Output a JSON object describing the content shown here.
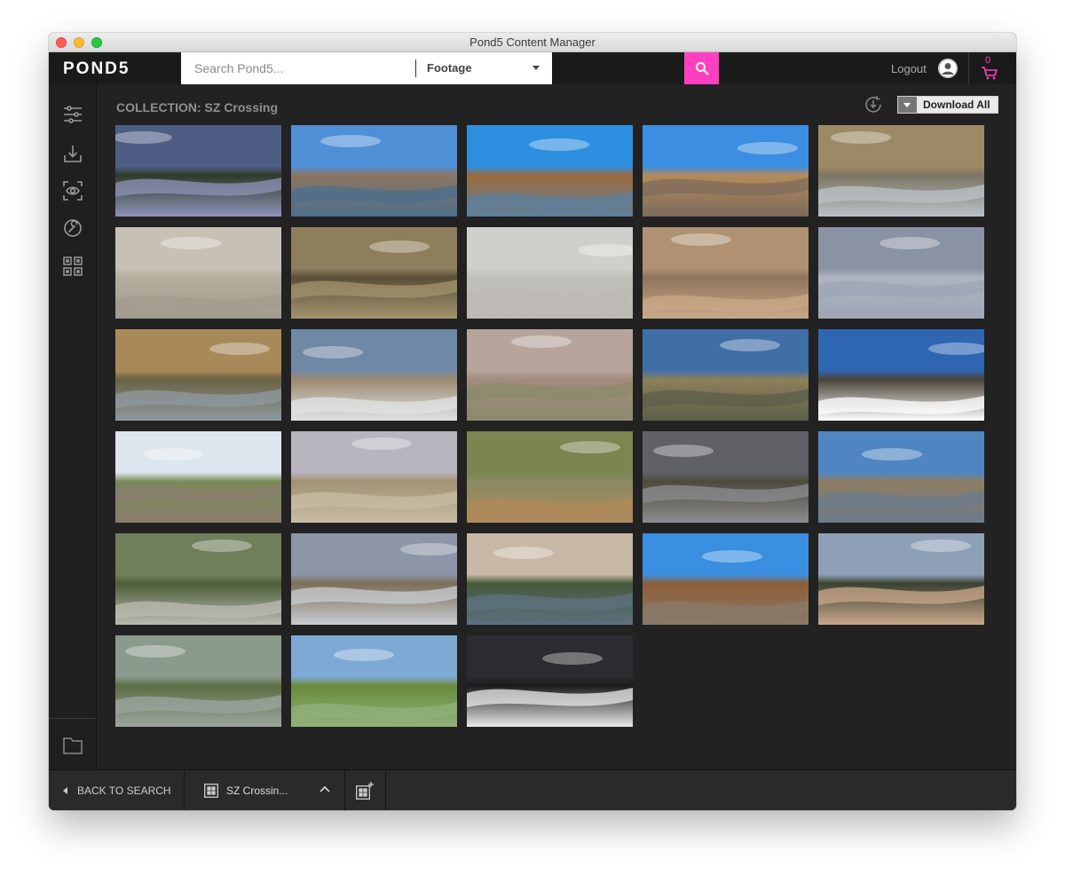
{
  "window": {
    "title": "Pond5 Content Manager"
  },
  "header": {
    "logo": "POND5",
    "search": {
      "placeholder": "Search Pond5...",
      "value": ""
    },
    "category": "Footage",
    "logout_label": "Logout",
    "cart_count": "0"
  },
  "sidebar": {
    "items": [
      {
        "icon": "sliders-icon"
      },
      {
        "icon": "download-tray-icon"
      },
      {
        "icon": "eye-scan-icon"
      },
      {
        "icon": "wrench-gear-icon"
      },
      {
        "icon": "qr-grid-icon"
      },
      {
        "icon": "folder-icon"
      }
    ]
  },
  "main": {
    "collection_title": "COLLECTION: SZ Crossing",
    "download_all_label": "Download All",
    "thumbnails": [
      {
        "scene": "river-storm-clouds",
        "colors": {
          "sky": "#4e5d84",
          "ground": "#2f3b2a",
          "water": "#8d93b8"
        }
      },
      {
        "scene": "river-canyon",
        "colors": {
          "sky": "#4f8fd6",
          "ground": "#8c7560",
          "water": "#4c6f8c"
        }
      },
      {
        "scene": "river-bridge-aerial",
        "colors": {
          "sky": "#2d8fe0",
          "ground": "#9c6a3c",
          "water": "#5e7f9c"
        }
      },
      {
        "scene": "river-desert-aerial",
        "colors": {
          "sky": "#3b8ee2",
          "ground": "#b58b5a",
          "water": "#7d6b5c"
        }
      },
      {
        "scene": "cranes-in-water",
        "colors": {
          "sky": "#9c8a66",
          "ground": "#7c7664",
          "water": "#b9c2c8"
        }
      },
      {
        "scene": "cranes-flying",
        "colors": {
          "sky": "#c7c0b4",
          "ground": "#b5ad9e",
          "water": "#a39c8e"
        }
      },
      {
        "scene": "crane-silhouettes",
        "colors": {
          "sky": "#8e7e5c",
          "ground": "#5a4e38",
          "water": "#a4946d"
        }
      },
      {
        "scene": "cranes-sky",
        "colors": {
          "sky": "#d1cfcb",
          "ground": "#c1bfba",
          "water": "#bdbab4"
        }
      },
      {
        "scene": "cranes-wading",
        "colors": {
          "sky": "#b09272",
          "ground": "#8d7459",
          "water": "#c9a887"
        }
      },
      {
        "scene": "cranes-blue-sky",
        "colors": {
          "sky": "#8a93a4",
          "ground": "#aeb4c1",
          "water": "#9ea6b5"
        }
      },
      {
        "scene": "cranes-wetland",
        "colors": {
          "sky": "#a88a5a",
          "ground": "#6a6244",
          "water": "#8f9aa0"
        }
      },
      {
        "scene": "snow-geese-flock",
        "colors": {
          "sky": "#6f88a6",
          "ground": "#9c8a70",
          "water": "#e1e3e6"
        }
      },
      {
        "scene": "desert-plain-aerial",
        "colors": {
          "sky": "#b7a59c",
          "ground": "#a18c7c",
          "water": "#8c8a6c"
        }
      },
      {
        "scene": "plain-clouds-shadow",
        "colors": {
          "sky": "#3f6fa6",
          "ground": "#8e7f5a",
          "water": "#5c5f4a"
        }
      },
      {
        "scene": "mesa-clouds",
        "colors": {
          "sky": "#2f66b2",
          "ground": "#4a4236",
          "water": "#ffffff"
        }
      },
      {
        "scene": "train-tracks",
        "colors": {
          "sky": "#dde6ee",
          "ground": "#7a8a58",
          "water": "#8a7d6c"
        }
      },
      {
        "scene": "rainbow-hills",
        "colors": {
          "sky": "#b9b5bf",
          "ground": "#a19274",
          "water": "#c8bda4"
        }
      },
      {
        "scene": "freight-train-scrub",
        "colors": {
          "sky": "#7a8550",
          "ground": "#8a8a62",
          "water": "#b08a5a"
        }
      },
      {
        "scene": "storm-cell",
        "colors": {
          "sky": "#5f6166",
          "ground": "#4e4a3c",
          "water": "#8b8c90"
        }
      },
      {
        "scene": "mountains-clouds",
        "colors": {
          "sky": "#4f86c2",
          "ground": "#8e7d63",
          "water": "#6c7b8c"
        }
      },
      {
        "scene": "highway-aerial",
        "colors": {
          "sky": "#6f7f5a",
          "ground": "#4d5f3a",
          "water": "#bcbab2"
        }
      },
      {
        "scene": "clouds-plain",
        "colors": {
          "sky": "#8c96a6",
          "ground": "#7d6e58",
          "water": "#c8ccd2"
        }
      },
      {
        "scene": "flooded-town",
        "colors": {
          "sky": "#c8b8a6",
          "ground": "#46593a",
          "water": "#5d7180"
        }
      },
      {
        "scene": "river-bosque-aerial",
        "colors": {
          "sky": "#3a8fe0",
          "ground": "#8e5e36",
          "water": "#8a7a6a"
        }
      },
      {
        "scene": "city-dusk",
        "colors": {
          "sky": "#8ea0b5",
          "ground": "#3b4230",
          "water": "#c9a78c"
        }
      },
      {
        "scene": "riverbank-reflection",
        "colors": {
          "sky": "#8a9a8c",
          "ground": "#5c6e42",
          "water": "#9ca6a0"
        }
      },
      {
        "scene": "green-valley",
        "colors": {
          "sky": "#7ea9d4",
          "ground": "#6a8a3c",
          "water": "#8fb27a"
        }
      },
      {
        "scene": "conference-audience",
        "colors": {
          "sky": "#2c2c30",
          "ground": "#1b1b1e",
          "water": "#e9e9ea"
        }
      }
    ]
  },
  "footer": {
    "back_label": "BACK TO SEARCH",
    "collection_tab_label": "SZ Crossin..."
  },
  "colors": {
    "accent": "#ff3fbf",
    "background": "#222223",
    "topbar": "#1a1a1b"
  }
}
